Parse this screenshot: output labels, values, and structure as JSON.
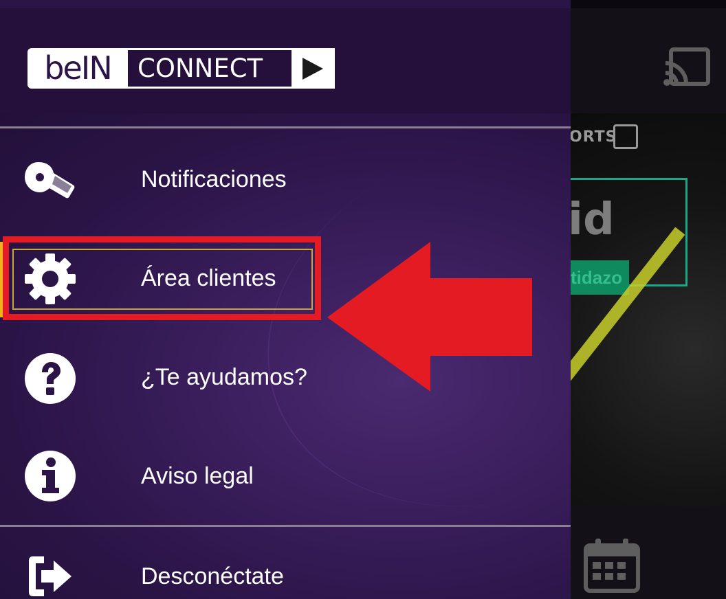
{
  "header": {
    "logo_bein": "beIN",
    "logo_connect": "CONNECT"
  },
  "menu": {
    "items": [
      {
        "label": "Notificaciones",
        "icon": "whistle-icon"
      },
      {
        "label": "Área clientes",
        "icon": "gear-icon"
      },
      {
        "label": "¿Te ayudamos?",
        "icon": "question-circle-icon"
      },
      {
        "label": "Aviso legal",
        "icon": "info-circle-icon"
      }
    ],
    "logout": {
      "label": "Desconéctate",
      "icon": "logout-icon"
    }
  },
  "background_app": {
    "sports_text": "ORTS",
    "title_fragment": "id",
    "badge_fragment": "tidazo",
    "icons": [
      "cast-icon",
      "calendar-icon"
    ]
  },
  "annotation": {
    "highlighted_item": "Área clientes",
    "color": "#e41b23"
  },
  "colors": {
    "drawer_bg": "#2b1446",
    "header_bg": "#24103b",
    "text": "#ffffff",
    "divider": "#8a8091",
    "highlight": "#e41b23",
    "accent": "#f2b21b"
  }
}
